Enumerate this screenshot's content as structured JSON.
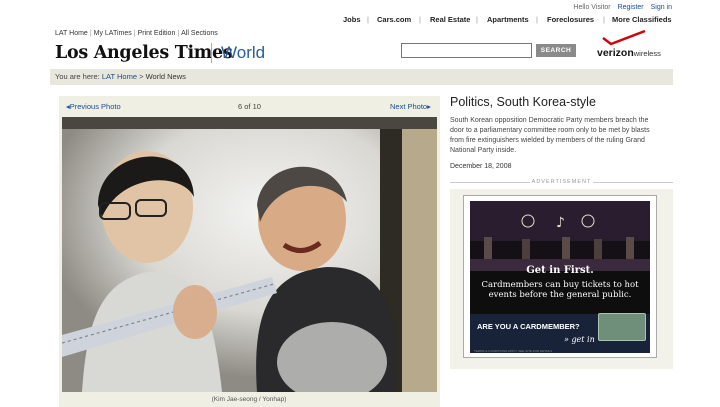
{
  "utility": {
    "greeting": "Hello Visitor",
    "register": "Register",
    "signin": "Sign in"
  },
  "nav": [
    "Jobs",
    "Cars.com",
    "Real Estate",
    "Apartments",
    "Foreclosures",
    "More Classifieds"
  ],
  "sub_links": [
    "LAT Home",
    "My LATimes",
    "Print Edition",
    "All Sections"
  ],
  "logo": "Los Angeles Times",
  "section": "World",
  "search": {
    "placeholder": "",
    "button": "SEARCH"
  },
  "sponsor": {
    "brand": "verizon",
    "suffix": "wireless",
    "accent": "#cd040b"
  },
  "breadcrumb": {
    "prefix": "You are here:",
    "home": "LAT Home",
    "separator": ">",
    "current": "World News"
  },
  "gallery": {
    "prev_label": "Previous Photo",
    "counter": "6 of 10",
    "next_label": "Next Photo",
    "credit": "(Kim Jae-seong / Yonhap)"
  },
  "article": {
    "headline": "Politics, South Korea-style",
    "caption": "South Korean opposition Democratic Party members breach the door to a parliamentary committee room only to be met by blasts from fire extinguishers wielded by members of the ruling Grand National Party inside.",
    "date": "December 18, 2008"
  },
  "ad": {
    "label": "ADVERTISEMENT",
    "title": "Get in First.",
    "body": "Cardmembers can buy tickets to hot events before the general public.",
    "cta": "ARE YOU A CARDMEMBER?",
    "getin": "» get in",
    "fine_print": "TERMS & CONDITIONS APPLY. SEE SITE FOR DETAILS"
  },
  "colors": {
    "link": "#1a4c8c",
    "section": "#2a5d9a",
    "breadcrumb_bg": "#e7e7dd",
    "panel_bg": "#efefe4"
  }
}
